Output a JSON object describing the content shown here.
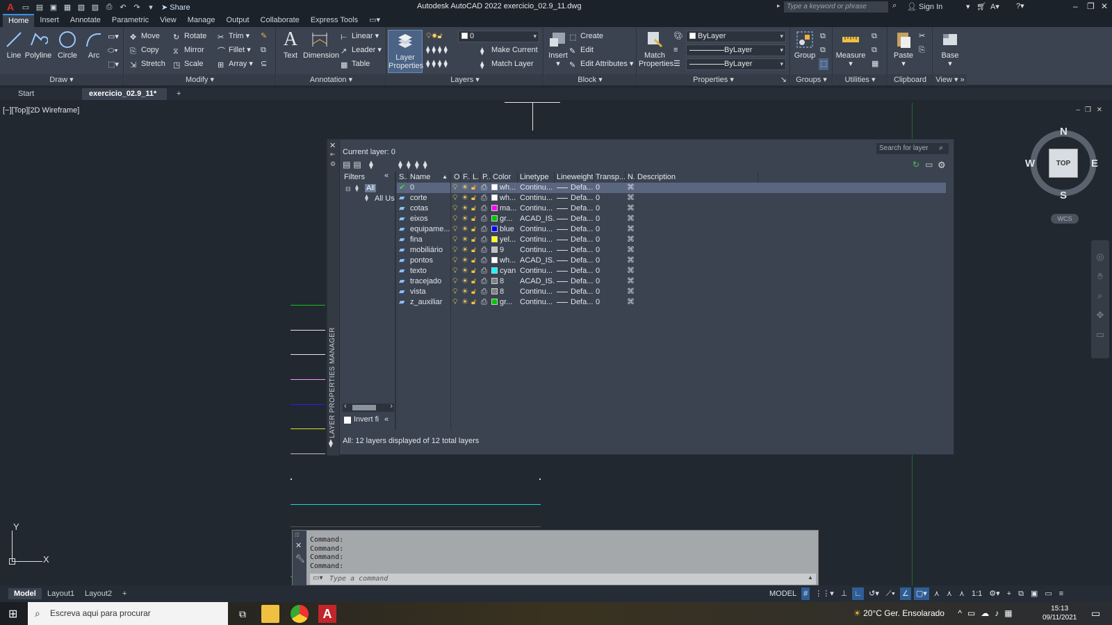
{
  "titlebar": {
    "app_logo": "A",
    "share": "Share",
    "title": "Autodesk AutoCAD 2022   exercicio_02.9_11.dwg",
    "search_placeholder": "Type a keyword or phrase",
    "sign_in": "Sign In"
  },
  "menu_tabs": [
    "Home",
    "Insert",
    "Annotate",
    "Parametric",
    "View",
    "Manage",
    "Output",
    "Collaborate",
    "Express Tools"
  ],
  "ribbon": {
    "draw": {
      "title": "Draw",
      "line": "Line",
      "polyline": "Polyline",
      "circle": "Circle",
      "arc": "Arc"
    },
    "modify": {
      "title": "Modify",
      "move": "Move",
      "rotate": "Rotate",
      "trim": "Trim",
      "copy": "Copy",
      "mirror": "Mirror",
      "fillet": "Fillet",
      "stretch": "Stretch",
      "scale": "Scale",
      "array": "Array"
    },
    "annotation": {
      "title": "Annotation",
      "text": "Text",
      "dimension": "Dimension",
      "linear": "Linear",
      "leader": "Leader",
      "table": "Table"
    },
    "layers": {
      "title": "Layers",
      "layer_properties": "Layer Properties",
      "current_layer": "0",
      "make_current": "Make Current",
      "match_layer": "Match Layer"
    },
    "block": {
      "title": "Block",
      "insert": "Insert",
      "create": "Create",
      "edit": "Edit",
      "edit_attributes": "Edit Attributes"
    },
    "properties": {
      "title": "Properties",
      "match_properties": "Match Properties",
      "color": "ByLayer",
      "linetype": "ByLayer",
      "lineweight": "ByLayer"
    },
    "groups": {
      "title": "Groups",
      "group": "Group"
    },
    "utilities": {
      "title": "Utilities",
      "measure": "Measure"
    },
    "clipboard": {
      "title": "Clipboard",
      "paste": "Paste"
    },
    "view": {
      "title": "View",
      "base": "Base"
    }
  },
  "file_tabs": {
    "start": "Start",
    "active": "exercicio_02.9_11*"
  },
  "viewport_label": "[−][Top][2D Wireframe]",
  "layer_manager": {
    "side_title": "LAYER PROPERTIES MANAGER",
    "current_layer": "Current layer: 0",
    "search_placeholder": "Search for layer",
    "filters_label": "Filters",
    "filter_all": "All",
    "filter_all_used": "All Us",
    "invert_filter": "Invert fi",
    "status": "All: 12 layers displayed of 12 total layers",
    "columns": {
      "status": "S..",
      "name": "Name",
      "on": "O..",
      "freeze": "F..",
      "lock": "L..",
      "plot": "P..",
      "color": "Color",
      "linetype": "Linetype",
      "lineweight": "Lineweight",
      "transparency": "Transp...",
      "newvp": "N..",
      "description": "Description"
    },
    "rows": [
      {
        "name": "0",
        "color": "wh...",
        "swatch": "#ffffff",
        "linetype": "Continu...",
        "lineweight": "Defa...",
        "transp": "0",
        "current": true
      },
      {
        "name": "corte",
        "color": "wh...",
        "swatch": "#ffffff",
        "linetype": "Continu...",
        "lineweight": "Defa...",
        "transp": "0"
      },
      {
        "name": "cotas",
        "color": "ma...",
        "swatch": "#ff00ff",
        "linetype": "Continu...",
        "lineweight": "Defa...",
        "transp": "0"
      },
      {
        "name": "eixos",
        "color": "gr...",
        "swatch": "#00c800",
        "linetype": "ACAD_IS...",
        "lineweight": "Defa...",
        "transp": "0"
      },
      {
        "name": "equipame...",
        "color": "blue",
        "swatch": "#0000ff",
        "linetype": "Continu...",
        "lineweight": "Defa...",
        "transp": "0"
      },
      {
        "name": "fina",
        "color": "yel...",
        "swatch": "#ffff00",
        "linetype": "Continu...",
        "lineweight": "Defa...",
        "transp": "0"
      },
      {
        "name": "mobiliário",
        "color": "9",
        "swatch": "#c0c0c0",
        "linetype": "Continu...",
        "lineweight": "Defa...",
        "transp": "0"
      },
      {
        "name": "pontos",
        "color": "wh...",
        "swatch": "#ffffff",
        "linetype": "ACAD_IS...",
        "lineweight": "Defa...",
        "transp": "0"
      },
      {
        "name": "texto",
        "color": "cyan",
        "swatch": "#00ffff",
        "linetype": "Continu...",
        "lineweight": "Defa...",
        "transp": "0"
      },
      {
        "name": "tracejado",
        "color": "8",
        "swatch": "#808080",
        "linetype": "ACAD_IS...",
        "lineweight": "Defa...",
        "transp": "0"
      },
      {
        "name": "vista",
        "color": "8",
        "swatch": "#808080",
        "linetype": "Continu...",
        "lineweight": "Defa...",
        "transp": "0"
      },
      {
        "name": "z_auxiliar",
        "color": "gr...",
        "swatch": "#00c800",
        "linetype": "Continu...",
        "lineweight": "Defa...",
        "transp": "0"
      }
    ]
  },
  "compass": {
    "n": "N",
    "s": "S",
    "e": "E",
    "w": "W",
    "top": "TOP",
    "wcs": "WCS"
  },
  "command": {
    "history": [
      "Command:",
      "Command:",
      "Command:",
      "Command:"
    ],
    "placeholder": "Type a command"
  },
  "layout_tabs": [
    "Model",
    "Layout1",
    "Layout2"
  ],
  "statusbar": {
    "model": "MODEL",
    "scale": "1:1"
  },
  "taskbar": {
    "search": "Escreva aqui para procurar",
    "weather": "20°C  Ger. Ensolarado",
    "time": "15:13",
    "date": "09/11/2021"
  },
  "axes": {
    "x": "X",
    "y": "Y"
  },
  "colors": {
    "accent": "#3b8ee8",
    "selected_row": "#5a6680",
    "panel": "#3b4350"
  }
}
